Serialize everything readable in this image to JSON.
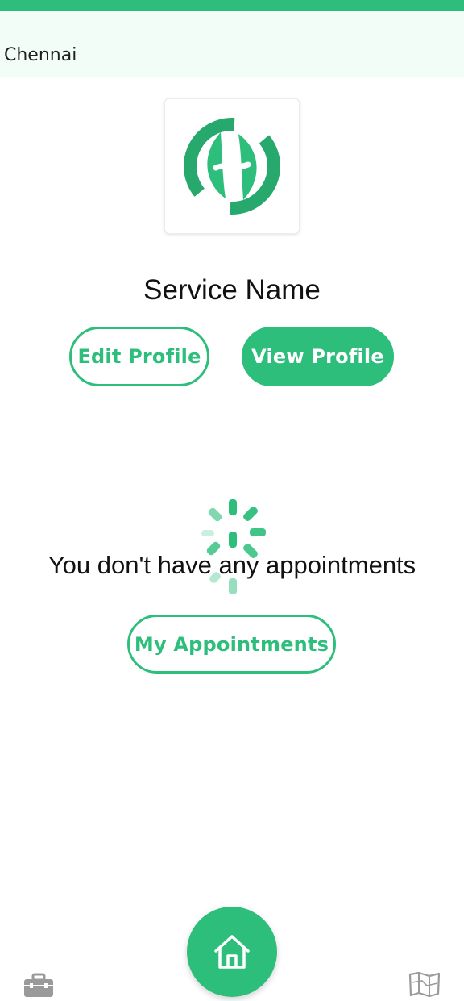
{
  "header": {
    "location": "Chennai"
  },
  "profile": {
    "logo_icon": "leaf-logo-icon",
    "service_name": "Service Name",
    "edit_label": "Edit Profile",
    "view_label": "View Profile"
  },
  "appointments": {
    "empty_message": "You don't have any appointments",
    "my_appointments_label": "My Appointments",
    "loading_icon": "spinner-icon"
  },
  "bottom_nav": {
    "left_icon": "briefcase-icon",
    "center_icon": "home-icon",
    "right_icon": "map-icon"
  },
  "colors": {
    "accent": "#2dbe7c",
    "location_bar_bg": "#f3fdf8",
    "icon_gray": "#9a9a9a"
  }
}
